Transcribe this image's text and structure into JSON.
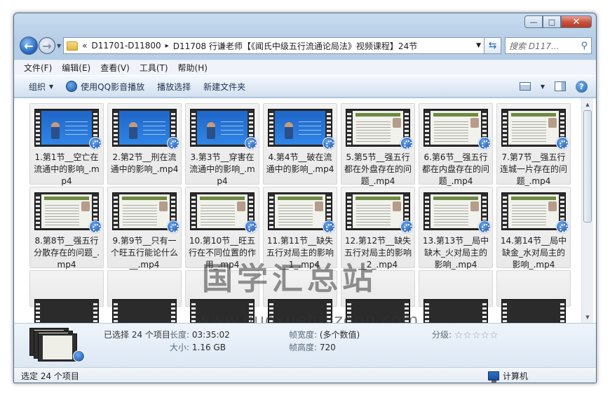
{
  "window": {
    "caption_buttons": {
      "minimize": "—",
      "maximize": "□",
      "close": "✕"
    }
  },
  "nav": {
    "back_glyph": "←",
    "forward_glyph": "→",
    "address": {
      "overflow": "«",
      "segments": [
        "D11701-D11800",
        "D11708 行谦老师【《闻氏中级五行流通论局法》视频课程】24节"
      ],
      "separator": "▸"
    },
    "refresh_glyph": "⇆",
    "search_placeholder": "搜索 D117...",
    "search_icon": "search-icon"
  },
  "menu": [
    "文件(F)",
    "编辑(E)",
    "查看(V)",
    "工具(T)",
    "帮助(H)"
  ],
  "toolbar": {
    "organize": "组织",
    "play_qq": "使用QQ影音播放",
    "play_selection": "播放选择",
    "new_folder": "新建文件夹",
    "help": "?"
  },
  "files": [
    {
      "label": "1.第1节__空亡在流通中的影响_.mp4",
      "style": "video"
    },
    {
      "label": "2.第2节__刑在流通中的影响_.mp4",
      "style": "video"
    },
    {
      "label": "3.第3节__穿害在流通中的影响_.mp4",
      "style": "video"
    },
    {
      "label": "4.第4节__破在流通中的影响_.mp4",
      "style": "video"
    },
    {
      "label": "5.第5节__强五行都在外盘存在的问题_.mp4",
      "style": "slide"
    },
    {
      "label": "6.第6节__强五行都在内盘存在的问题_.mp4",
      "style": "slide"
    },
    {
      "label": "7.第7节__强五行连城一片存在的问题_.mp4",
      "style": "slide"
    },
    {
      "label": "8.第8节__强五行分散存在的问题_.mp4",
      "style": "slide"
    },
    {
      "label": "9.第9节__只有一个旺五行能论什么__.mp4",
      "style": "slide"
    },
    {
      "label": "10.第10节__旺五行在不同位置的作用_.mp4",
      "style": "slide"
    },
    {
      "label": "11.第11节__缺失五行对局主的影响__1_.mp4",
      "style": "slide"
    },
    {
      "label": "12.第12节__缺失五行对局主的影响__2_.mp4",
      "style": "slide"
    },
    {
      "label": "13.第13节__局中缺木_火对局主的影响_.mp4",
      "style": "slide"
    },
    {
      "label": "14.第14节__局中缺金_水对局主的影响_.mp4",
      "style": "slide"
    }
  ],
  "partial_row_count": 7,
  "watermark": {
    "title": "国学汇总站",
    "url": "www.guoxuehuizong.com"
  },
  "details": {
    "selected": "已选择 24 个项目",
    "length_label": "长度:",
    "length_value": "03:35:02",
    "size_label": "大小:",
    "size_value": "1.16 GB",
    "frame_width_label": "帧宽度:",
    "frame_width_value": "(多个数值)",
    "frame_height_label": "帧高度:",
    "frame_height_value": "720",
    "rating_label": "分级:",
    "rating_stars": "☆☆☆☆☆"
  },
  "status": {
    "left": "选定 24 个项目",
    "right": "计算机"
  }
}
